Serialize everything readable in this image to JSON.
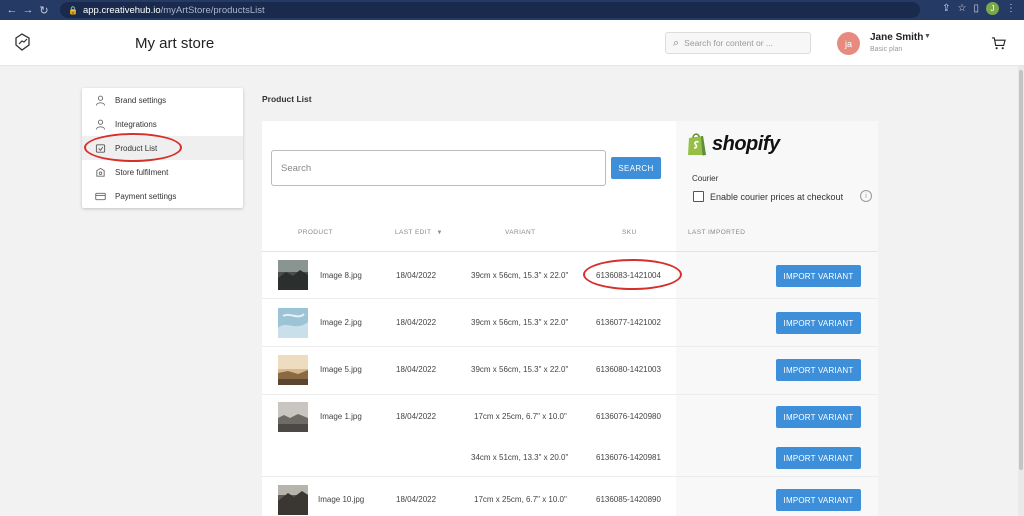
{
  "browser": {
    "back_icon": "←",
    "forward_icon": "→",
    "reload_icon": "↻",
    "lock_icon": "🔒",
    "url_host": "app.creativehub.io",
    "url_path": "/myArtStore/productsList",
    "share_icon": "⇪",
    "star_icon": "☆",
    "sidepanel_icon": "▯",
    "profile_initial": "J",
    "menu_icon": "⋮"
  },
  "header": {
    "store_title": "My art store",
    "search_placeholder": "Search for content or ...",
    "search_icon": "⌕",
    "avatar_initials": "ja",
    "user_name": "Jane Smith",
    "user_caret": "▼",
    "user_plan": "Basic plan"
  },
  "sidebar": {
    "items": [
      {
        "label": "Brand settings"
      },
      {
        "label": "Integrations"
      },
      {
        "label": "Product List"
      },
      {
        "label": "Store fulfilment"
      },
      {
        "label": "Payment settings"
      }
    ]
  },
  "main": {
    "heading": "Product List",
    "search_placeholder": "Search",
    "search_button": "SEARCH",
    "shopify_word": "shopify",
    "courier_label": "Courier",
    "courier_checkbox_label": "Enable courier prices at checkout",
    "info_icon": "i",
    "columns": {
      "product": "PRODUCT",
      "last_edit": "LAST EDIT",
      "sort_icon": "▼",
      "variant": "VARIANT",
      "sku": "SKU",
      "last_imported": "LAST IMPORTED"
    },
    "import_label": "IMPORT VARIANT",
    "rows": [
      {
        "name": "Image 8.jpg",
        "date": "18/04/2022",
        "variant": "39cm x 56cm, 15.3\" x 22.0\"",
        "sku": "6136083-1421004"
      },
      {
        "name": "Image 2.jpg",
        "date": "18/04/2022",
        "variant": "39cm x 56cm, 15.3\" x 22.0\"",
        "sku": "6136077-1421002"
      },
      {
        "name": "Image 5.jpg",
        "date": "18/04/2022",
        "variant": "39cm x 56cm, 15.3\" x 22.0\"",
        "sku": "6136080-1421003"
      },
      {
        "name": "Image 1.jpg",
        "date": "18/04/2022",
        "variant": "17cm x 25cm, 6.7\" x 10.0\"",
        "sku": "6136076-1420980"
      },
      {
        "variant": "34cm x 51cm, 13.3\" x 20.0\"",
        "sku": "6136076-1420981"
      },
      {
        "name": "Image 10.jpg",
        "date": "18/04/2022",
        "variant": "17cm x 25cm, 6.7\" x 10.0\"",
        "sku": "6136085-1420890"
      }
    ]
  },
  "colors": {
    "accent": "#3d8fd9",
    "annotation": "#d6302a",
    "shopify_green": "#95bf47"
  }
}
